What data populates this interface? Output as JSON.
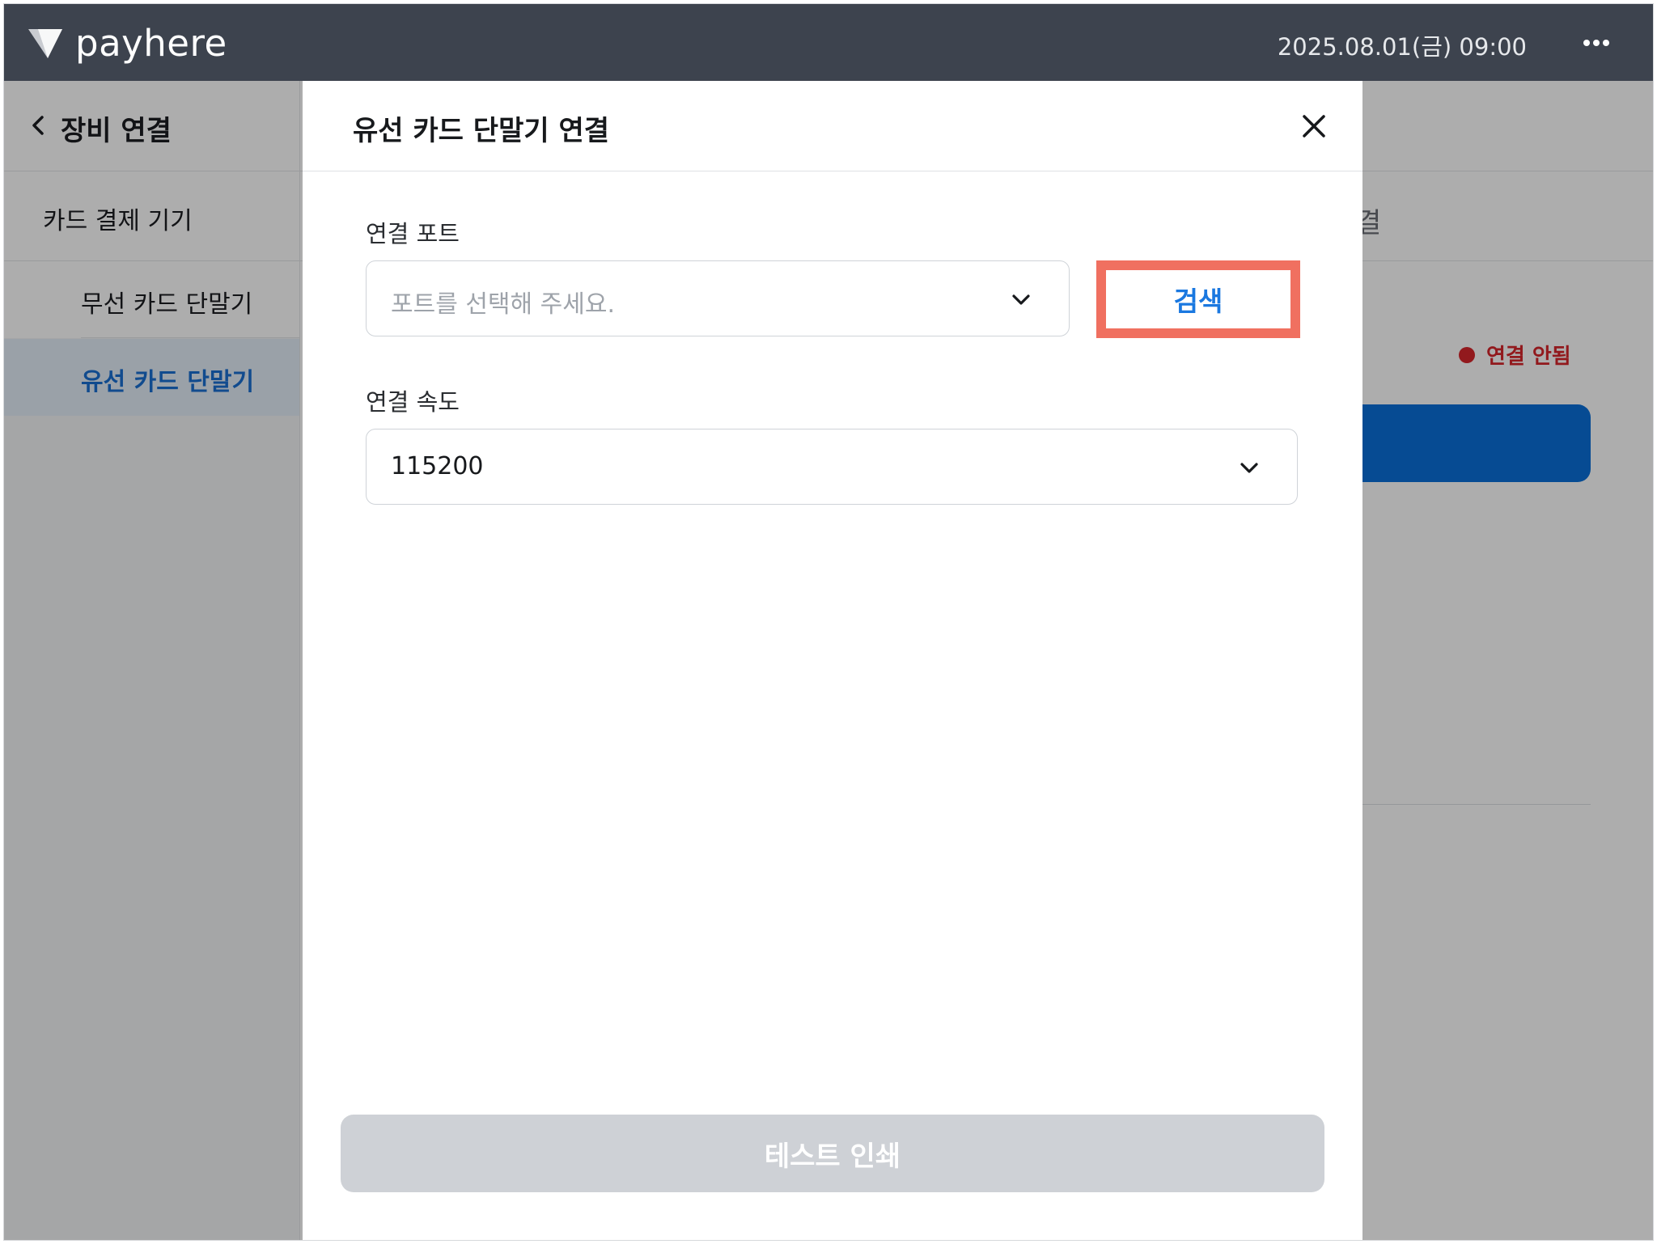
{
  "topbar": {
    "brand": "payhere",
    "datetime": "2025.08.01(금) 09:00",
    "more_icon": "more-horizontal-icon"
  },
  "sidebar": {
    "title": "장비 연결",
    "section": "카드 결제 기기",
    "items": [
      {
        "label": "무선 카드 단말기",
        "active": false
      },
      {
        "label": "유선 카드 단말기",
        "active": true
      }
    ]
  },
  "main": {
    "tab_partial": "결",
    "status": "연결 안됨"
  },
  "modal": {
    "title": "유선 카드 단말기 연결",
    "port_label": "연결 포트",
    "port_placeholder": "포트를 선택해 주세요.",
    "search_label": "검색",
    "speed_label": "연결 속도",
    "speed_value": "115200",
    "test_print_label": "테스트 인쇄"
  },
  "colors": {
    "topbar_bg": "#3d434e",
    "accent_blue": "#1a78e0",
    "status_red": "#d7262c",
    "highlight": "#f07060",
    "disabled_button": "#ced1d6"
  }
}
